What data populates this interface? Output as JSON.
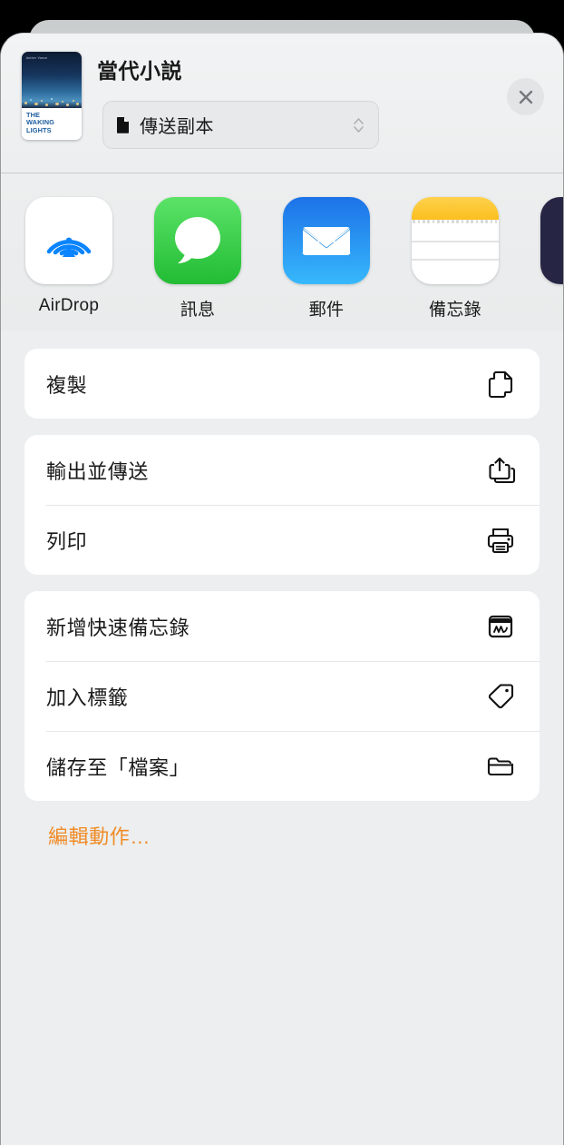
{
  "sheet": {
    "title": "當代小説",
    "format_selector": {
      "label": "傳送副本",
      "icon": "document-icon",
      "chevron": "chevron-up-down-icon"
    },
    "close_label": "close-icon",
    "thumbnail": {
      "author": "Amber Vance",
      "title_line1": "THE",
      "title_line2": "WAKING",
      "title_line3": "LIGHTS"
    }
  },
  "apps": [
    {
      "label": "AirDrop",
      "icon": "airdrop-icon"
    },
    {
      "label": "訊息",
      "icon": "messages-icon"
    },
    {
      "label": "郵件",
      "icon": "mail-icon"
    },
    {
      "label": "備忘錄",
      "icon": "notes-icon"
    },
    {
      "label": "",
      "icon": "podcasts-icon"
    }
  ],
  "action_groups": [
    {
      "rows": [
        {
          "label": "複製",
          "icon": "copy-icon"
        }
      ]
    },
    {
      "rows": [
        {
          "label": "輸出並傳送",
          "icon": "export-share-icon"
        },
        {
          "label": "列印",
          "icon": "printer-icon"
        }
      ]
    },
    {
      "rows": [
        {
          "label": "新增快速備忘錄",
          "icon": "quick-note-icon"
        },
        {
          "label": "加入標籤",
          "icon": "tag-icon"
        },
        {
          "label": "儲存至「檔案」",
          "icon": "folder-icon"
        }
      ]
    }
  ],
  "edit_actions": {
    "label": "編輯動作…",
    "color": "#F08C28"
  },
  "colors": {
    "sheet_background": "#eceeef",
    "card_background": "#ffffff",
    "text_primary": "#1a1a1a",
    "accent_orange": "#F08C28",
    "messages_green": "#22BC34",
    "mail_blue": "#1C72E8",
    "notes_yellow": "#FBBF20",
    "airdrop_blue": "#0A84FF"
  }
}
